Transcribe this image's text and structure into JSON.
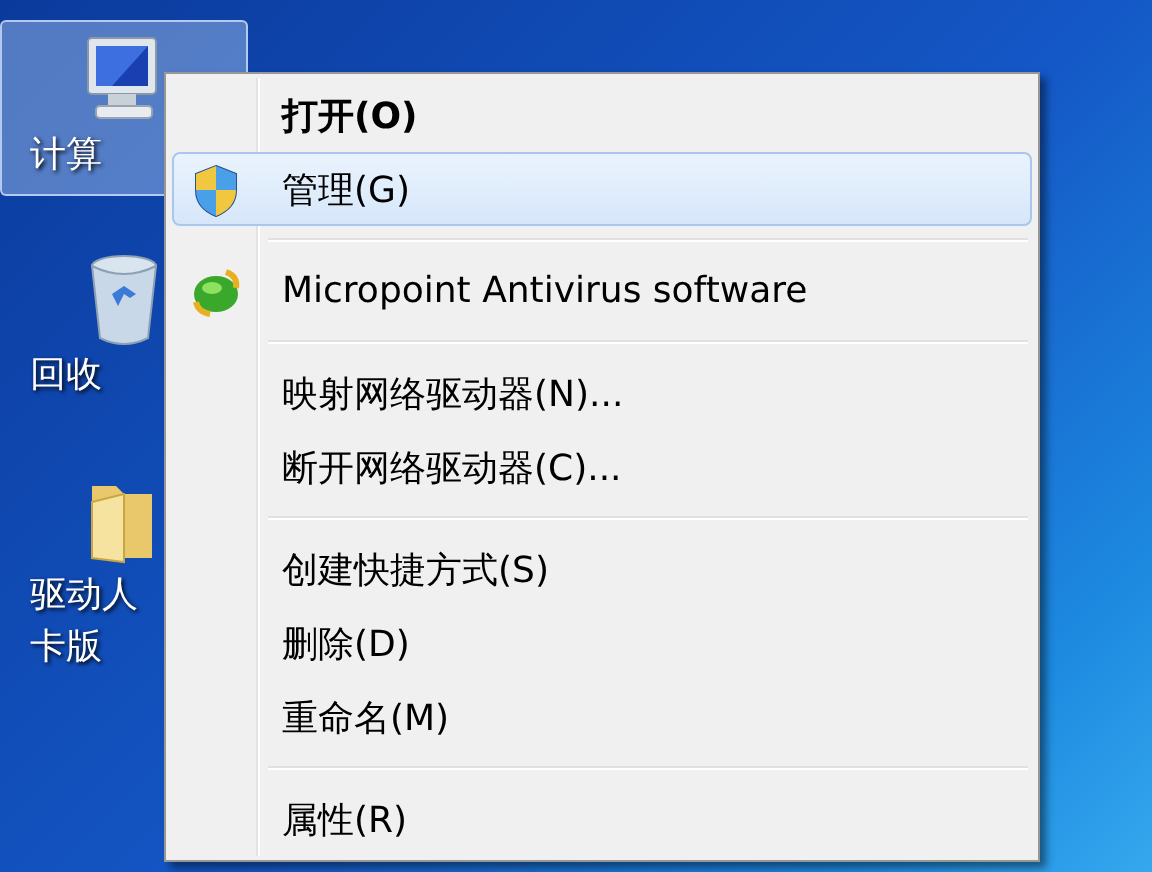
{
  "desktop_icons": [
    {
      "label": "计算",
      "selected": true
    },
    {
      "label": "回收",
      "selected": false
    },
    {
      "label": "驱动人",
      "label_2": "卡版",
      "selected": false
    }
  ],
  "context_menu": {
    "items": [
      {
        "kind": "command",
        "label": "打开(O)",
        "default": true,
        "selected": false
      },
      {
        "kind": "command",
        "label": "管理(G)",
        "default": false,
        "selected": true
      },
      {
        "kind": "separator"
      },
      {
        "kind": "command",
        "label": "Micropoint Antivirus software",
        "default": false,
        "selected": false
      },
      {
        "kind": "separator"
      },
      {
        "kind": "command",
        "label": "映射网络驱动器(N)...",
        "default": false,
        "selected": false
      },
      {
        "kind": "command",
        "label": "断开网络驱动器(C)...",
        "default": false,
        "selected": false
      },
      {
        "kind": "separator"
      },
      {
        "kind": "command",
        "label": "创建快捷方式(S)",
        "default": false,
        "selected": false
      },
      {
        "kind": "command",
        "label": "删除(D)",
        "default": false,
        "selected": false
      },
      {
        "kind": "command",
        "label": "重命名(M)",
        "default": false,
        "selected": false
      },
      {
        "kind": "separator"
      },
      {
        "kind": "command",
        "label": "属性(R)",
        "default": false,
        "selected": false
      }
    ]
  }
}
